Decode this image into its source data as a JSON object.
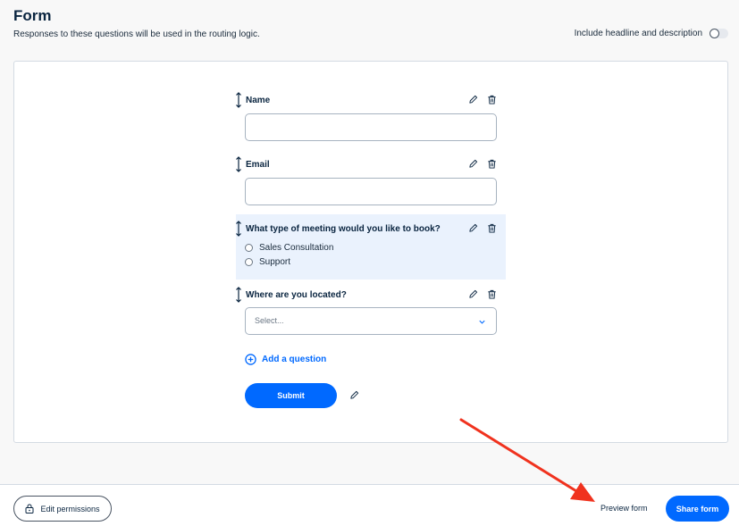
{
  "header": {
    "title": "Form",
    "subtitle": "Responses to these questions will be used in the routing logic.",
    "toggle_label": "Include headline and description",
    "toggle_on": false
  },
  "questions": [
    {
      "label": "Name",
      "type": "text"
    },
    {
      "label": "Email",
      "type": "text"
    },
    {
      "label": "What type of meeting would you like to book?",
      "type": "radio",
      "options": [
        "Sales Consultation",
        "Support"
      ]
    },
    {
      "label": "Where are you located?",
      "type": "select",
      "placeholder": "Select..."
    }
  ],
  "add_question_label": "Add a question",
  "submit_label": "Submit",
  "footer": {
    "edit_permissions_label": "Edit permissions",
    "preview_label": "Preview form",
    "share_label": "Share form"
  },
  "colors": {
    "accent": "#0069ff",
    "highlight": "#eaf2fd",
    "annotation_arrow": "#f0321e"
  },
  "icons": [
    "drag-handle-icon",
    "pencil-icon",
    "trash-icon",
    "plus-circle-icon",
    "chevron-down-icon",
    "lock-icon"
  ]
}
